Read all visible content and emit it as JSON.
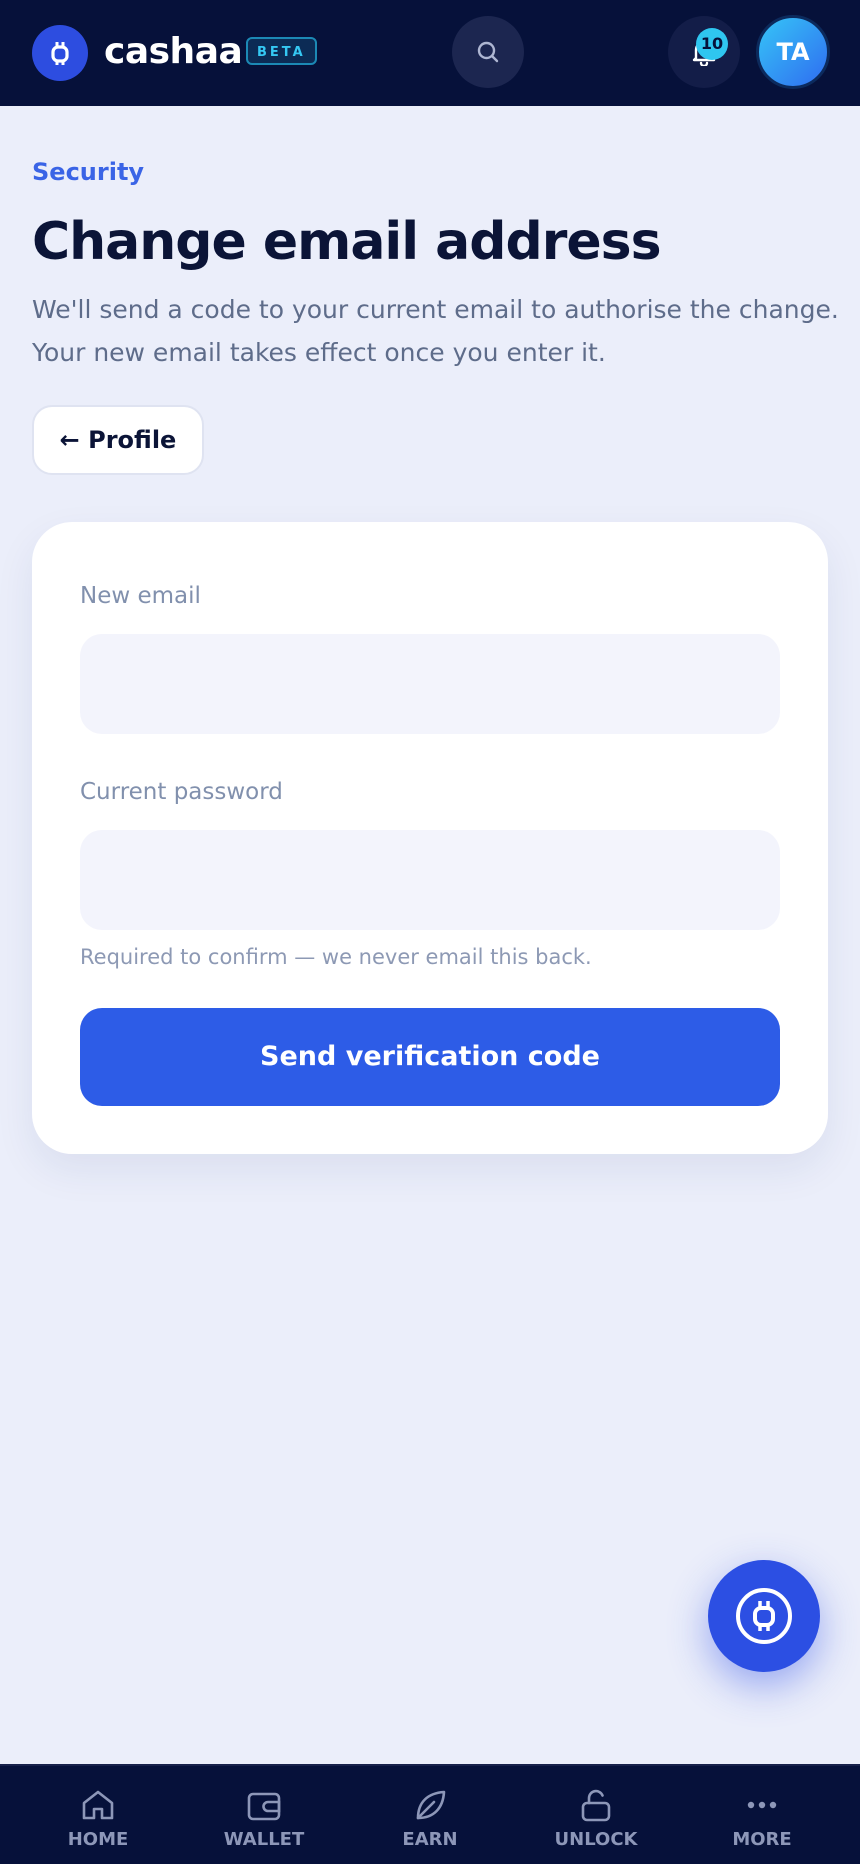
{
  "header": {
    "brand_name": "cashaa",
    "beta_label": "BETA",
    "notification_count": "10",
    "avatar_initials": "TA",
    "icons": {
      "logo": "cashaa-logo-icon",
      "search": "search-icon",
      "notifications": "bell-icon"
    }
  },
  "page": {
    "section_label": "Security",
    "title": "Change email address",
    "description": "We'll send a code to your current email to authorise the change. Your new email takes effect once you enter it.",
    "back_button_label": "← Profile"
  },
  "form": {
    "new_email_label": "New email",
    "new_email_value": "",
    "current_password_label": "Current password",
    "current_password_value": "",
    "password_hint": "Required to confirm — we never email this back.",
    "submit_label": "Send verification code"
  },
  "bottom_nav": {
    "items": [
      {
        "label": "HOME",
        "icon": "home-icon"
      },
      {
        "label": "WALLET",
        "icon": "wallet-icon"
      },
      {
        "label": "EARN",
        "icon": "leaf-icon"
      },
      {
        "label": "UNLOCK",
        "icon": "unlock-icon"
      },
      {
        "label": "MORE",
        "icon": "more-icon"
      }
    ]
  },
  "colors": {
    "header_bg": "#06113a",
    "page_bg": "#ebeefa",
    "accent": "#2d5ce7",
    "beta_cyan": "#35c8f3",
    "title_text": "#0b1437",
    "muted_text": "#5e6c8a"
  }
}
